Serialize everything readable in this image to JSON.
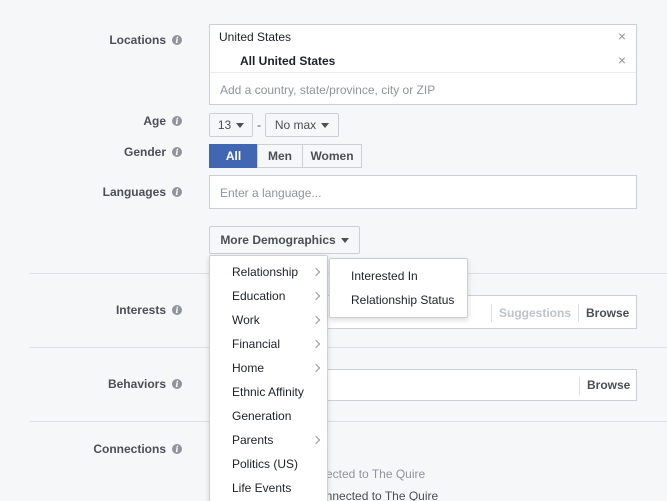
{
  "locations": {
    "label": "Locations",
    "country": "United States",
    "sub": "All United States",
    "placeholder": "Add a country, state/province, city or ZIP",
    "remove_glyph": "×"
  },
  "age": {
    "label": "Age",
    "min": "13",
    "separator": "-",
    "max": "No max"
  },
  "gender": {
    "label": "Gender",
    "options": [
      "All",
      "Men",
      "Women"
    ],
    "selected": "All"
  },
  "languages": {
    "label": "Languages",
    "placeholder": "Enter a language..."
  },
  "more_demographics": {
    "label": "More Demographics"
  },
  "interests": {
    "label": "Interests",
    "suggestions": "Suggestions",
    "browse": "Browse"
  },
  "behaviors": {
    "label": "Behaviors",
    "browse": "Browse"
  },
  "connections": {
    "label": "Connections",
    "option1_partial": "ected to The Quire",
    "option2_partial": "onnected to The Quire"
  },
  "demographics_menu": {
    "items": [
      {
        "label": "Relationship",
        "submenu": true
      },
      {
        "label": "Education",
        "submenu": true
      },
      {
        "label": "Work",
        "submenu": true
      },
      {
        "label": "Financial",
        "submenu": true
      },
      {
        "label": "Home",
        "submenu": true
      },
      {
        "label": "Ethnic Affinity",
        "submenu": false
      },
      {
        "label": "Generation",
        "submenu": false
      },
      {
        "label": "Parents",
        "submenu": true
      },
      {
        "label": "Politics (US)",
        "submenu": false
      },
      {
        "label": "Life Events",
        "submenu": false
      }
    ]
  },
  "relationship_submenu": {
    "items": [
      "Interested In",
      "Relationship Status"
    ]
  },
  "info_glyph": "i",
  "colors": {
    "accent": "#4267b2",
    "border": "#ccd0d5",
    "background": "#f6f7f9",
    "muted": "#90949c"
  }
}
